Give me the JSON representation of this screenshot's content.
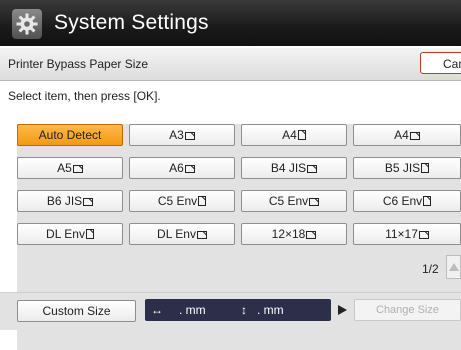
{
  "header": {
    "title": "System Settings"
  },
  "subheader": {
    "label": "Printer Bypass Paper Size",
    "cancel_label": "Can"
  },
  "instruction": "Select item, then press [OK].",
  "paper_sizes": [
    {
      "label": "Auto Detect",
      "icon": "",
      "selected": true
    },
    {
      "label": "A3",
      "icon": "landscape-icon",
      "selected": false
    },
    {
      "label": "A4",
      "icon": "portrait-icon",
      "selected": false
    },
    {
      "label": "A4",
      "icon": "landscape-icon",
      "selected": false
    },
    {
      "label": "A5",
      "icon": "landscape-icon",
      "selected": false
    },
    {
      "label": "A6",
      "icon": "landscape-icon",
      "selected": false
    },
    {
      "label": "B4 JIS",
      "icon": "landscape-icon",
      "selected": false
    },
    {
      "label": "B5 JIS",
      "icon": "portrait-icon",
      "selected": false
    },
    {
      "label": "B6 JIS",
      "icon": "landscape-icon",
      "selected": false
    },
    {
      "label": "C5 Env",
      "icon": "portrait-icon",
      "selected": false
    },
    {
      "label": "C5 Env",
      "icon": "landscape-icon",
      "selected": false
    },
    {
      "label": "C6 Env",
      "icon": "portrait-icon",
      "selected": false
    },
    {
      "label": "DL Env",
      "icon": "portrait-icon",
      "selected": false
    },
    {
      "label": "DL Env",
      "icon": "landscape-icon",
      "selected": false
    },
    {
      "label": "12×18",
      "icon": "landscape-icon",
      "selected": false
    },
    {
      "label": "11×17",
      "icon": "landscape-icon",
      "selected": false
    }
  ],
  "pager": {
    "text": "1/2"
  },
  "custom": {
    "button_label": "Custom Size",
    "width_arrow": "↔",
    "width_unit": ". mm",
    "height_arrow": "↕",
    "height_unit": ". mm",
    "change_label": "Change Size"
  },
  "colors": {
    "selected": "#f39a12",
    "title_bar": "#1a1a1a",
    "field": "#2b2f4a"
  }
}
